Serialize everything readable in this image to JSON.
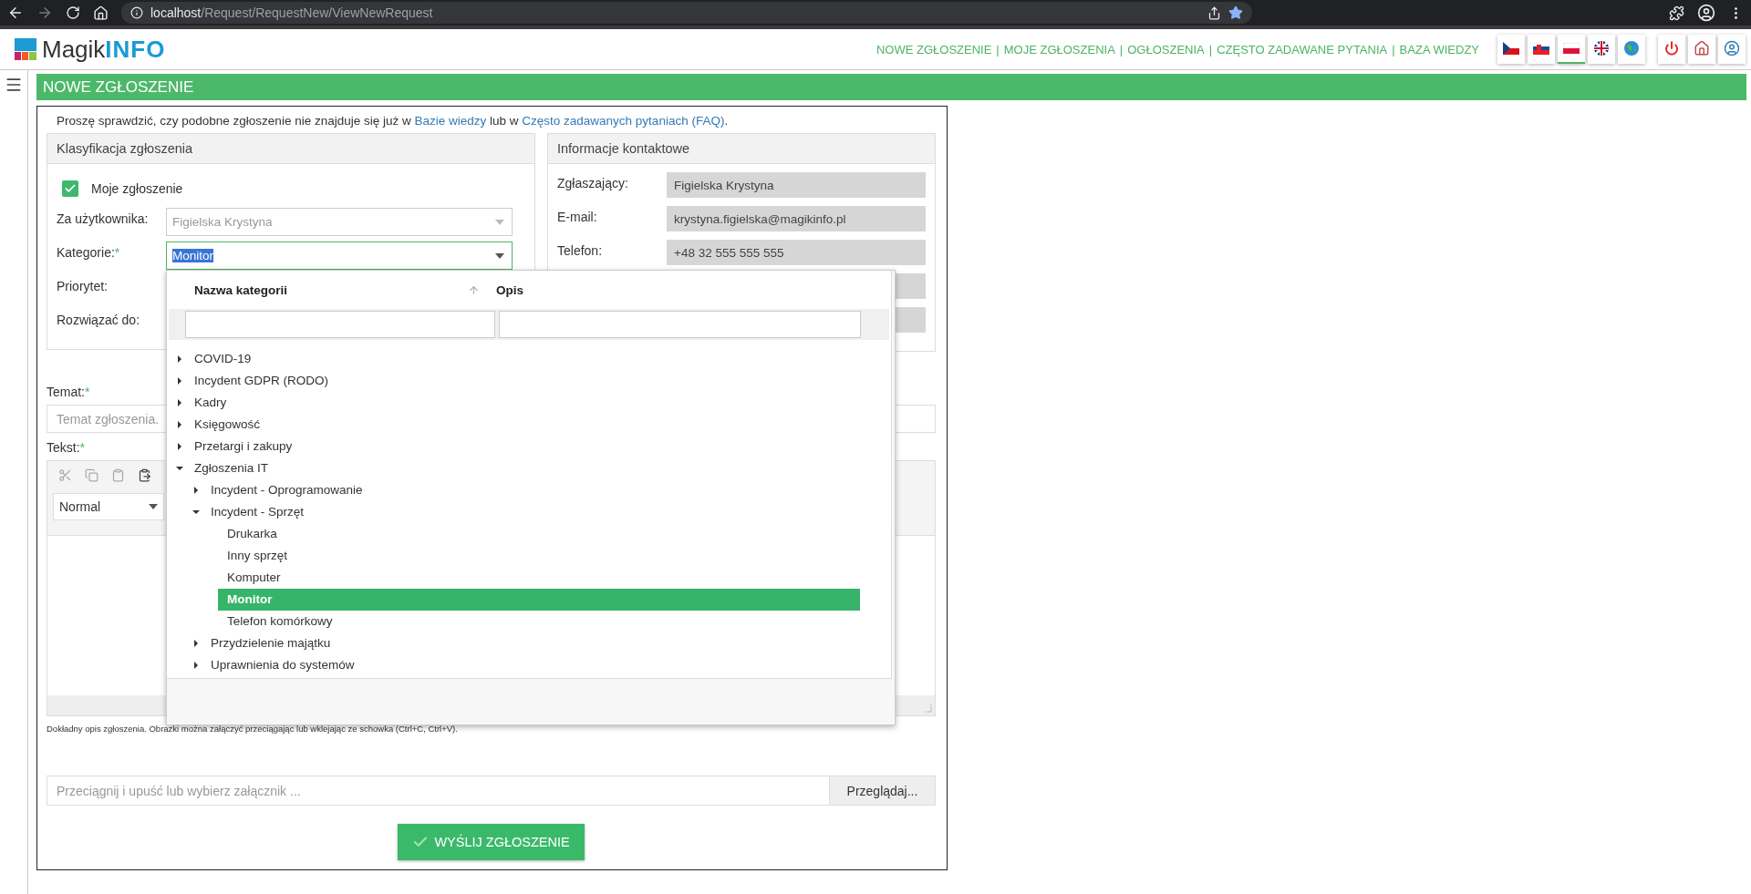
{
  "browser": {
    "url_host": "localhost",
    "url_path": "/Request/RequestNew/ViewNewRequest"
  },
  "header": {
    "logo": "Magik**INFO**",
    "separator": "|",
    "nav": [
      {
        "label": "NOWE ZGŁOSZENIE"
      },
      {
        "label": "MOJE ZGŁOSZENIA"
      },
      {
        "label": "OGŁOSZENIA"
      },
      {
        "label": "CZĘSTO ZADAWANE PYTANIA"
      },
      {
        "label": "BAZA WIEDZY"
      }
    ],
    "languages": [
      {
        "kind": "cz",
        "selected": false
      },
      {
        "kind": "sk",
        "selected": false
      },
      {
        "kind": "pl",
        "selected": true
      },
      {
        "kind": "gb",
        "selected": false
      },
      {
        "kind": "world",
        "selected": false
      }
    ]
  },
  "page_title": "NOWE ZGŁOSZENIE",
  "notice": [
    {
      "kind": "text",
      "text": "Proszę sprawdzić, czy podobne zgłoszenie nie znajduje się już w "
    },
    {
      "kind": "link",
      "text": "Bazie wiedzy"
    },
    {
      "kind": "text",
      "text": " lub w "
    },
    {
      "kind": "link",
      "text": "Często zadawanych pytaniach (FAQ)"
    },
    {
      "kind": "text",
      "text": "."
    }
  ],
  "classification": {
    "title": "Klasyfikacja zgłoszenia",
    "my_request": {
      "label": "Moje zgłoszenie",
      "checked": true
    },
    "fields": [
      {
        "label": "Za użytkownika:",
        "value": "Figielska Krystyna",
        "disabled": true
      },
      {
        "label": "Kategorie:",
        "required_mark": "*",
        "value": "Monitor",
        "open": true
      },
      {
        "label": "Priorytet:"
      },
      {
        "label": "Rozwiązać do:"
      }
    ]
  },
  "contact": {
    "title": "Informacje kontaktowe",
    "fields": [
      {
        "label": "Zgłaszający:",
        "value": "Figielska Krystyna"
      },
      {
        "label": "E-mail:",
        "value": "krystyna.figielska@magikinfo.pl"
      },
      {
        "label": "Telefon:",
        "value": "+48 32 555 555 555"
      }
    ]
  },
  "subject": {
    "label": "Temat:",
    "required_mark": "*",
    "placeholder": "Temat zgłoszenia."
  },
  "text": {
    "label": "Tekst:",
    "required_mark": "*",
    "format": "Normal",
    "hint": "Dokładny opis zgłoszenia. Obrazki można załączyć przeciągając lub wklejając ze schowka (Ctrl+C, Ctrl+V)."
  },
  "attachment": {
    "placeholder": "Przeciągnij i upuść lub wybierz załącznik ...",
    "button": "Przeglądaj..."
  },
  "submit": "WYŚLIJ ZGŁOSZENIE",
  "dropdown": {
    "columns": [
      "Nazwa kategorii",
      "Opis"
    ],
    "tree": [
      {
        "kind": "group",
        "label": "COVID-19",
        "expanded": false,
        "selected": false
      },
      {
        "kind": "group",
        "label": "Incydent GDPR (RODO)",
        "expanded": false,
        "selected": false
      },
      {
        "kind": "group",
        "label": "Kadry",
        "expanded": false,
        "selected": false
      },
      {
        "kind": "group",
        "label": "Księgowość",
        "expanded": false,
        "selected": false
      },
      {
        "kind": "group",
        "label": "Przetargi i zakupy",
        "expanded": false,
        "selected": false
      },
      {
        "kind": "group",
        "label": "Zgłoszenia IT",
        "expanded": true,
        "selected": false,
        "children": [
          {
            "kind": "group",
            "label": "Incydent - Oprogramowanie",
            "expanded": false,
            "selected": false
          },
          {
            "kind": "group",
            "label": "Incydent - Sprzęt",
            "expanded": true,
            "selected": false,
            "children": [
              {
                "kind": "leaf",
                "label": "Drukarka",
                "selected": false
              },
              {
                "kind": "leaf",
                "label": "Inny sprzęt",
                "selected": false
              },
              {
                "kind": "leaf",
                "label": "Komputer",
                "selected": false
              },
              {
                "kind": "leaf",
                "label": "Monitor",
                "selected": true
              },
              {
                "kind": "leaf",
                "label": "Telefon komórkowy",
                "selected": false
              }
            ]
          },
          {
            "kind": "group",
            "label": "Przydzielenie majątku",
            "expanded": false,
            "selected": false
          },
          {
            "kind": "group",
            "label": "Uprawnienia do systemów",
            "expanded": false,
            "selected": false
          }
        ]
      }
    ]
  }
}
